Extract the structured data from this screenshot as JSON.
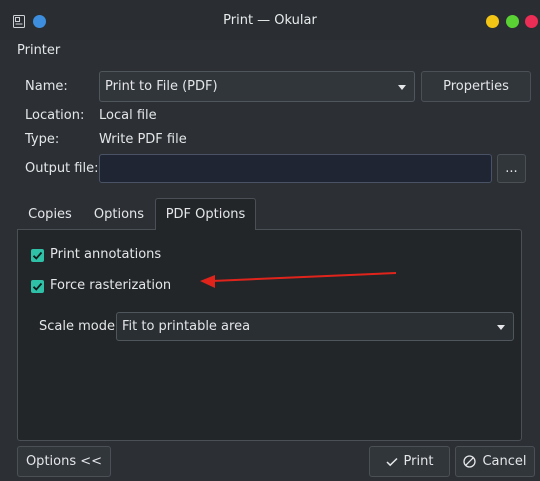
{
  "window": {
    "title": "Print — Okular"
  },
  "printer": {
    "section_title": "Printer",
    "name_label": "Name:",
    "name_value": "Print to File (PDF)",
    "properties_label": "Properties",
    "location_label": "Location:",
    "location_value": "Local file",
    "type_label": "Type:",
    "type_value": "Write PDF file",
    "output_label": "Output file:",
    "output_value": "",
    "browse_label": "..."
  },
  "tabs": [
    {
      "label": "Copies",
      "active": false
    },
    {
      "label": "Options",
      "active": false
    },
    {
      "label": "PDF Options",
      "active": true
    }
  ],
  "pdf_options": {
    "print_annotations": {
      "label": "Print annotations",
      "checked": true
    },
    "force_rasterization": {
      "label": "Force rasterization",
      "checked": true
    },
    "scale_mode_label": "Scale mode:",
    "scale_mode_value": "Fit to printable area"
  },
  "footer": {
    "options_label": "Options <<",
    "print_label": "Print",
    "cancel_label": "Cancel"
  },
  "colors": {
    "accent": "#2fc0a8",
    "annotation_arrow": "#e0241c",
    "window_bg": "#2c3035",
    "panel_bg": "#232629",
    "output_field_bg": "#1f2533"
  },
  "icons": {
    "app": "okular-print-icon",
    "window_menu": "window-menu-icon",
    "print": "checkmark-icon",
    "cancel": "cancel-icon"
  }
}
